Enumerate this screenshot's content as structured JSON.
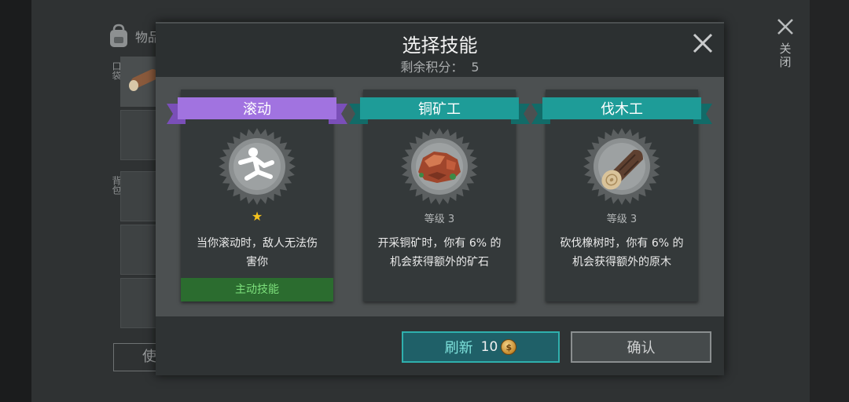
{
  "background": {
    "inventory_title": "物品",
    "pocket_label": "口袋",
    "backpack_label": "背包",
    "use_button": "使用",
    "close_label": "关闭"
  },
  "dialog": {
    "title": "选择技能",
    "points_label": "剩余积分：",
    "points_value": "5"
  },
  "cards": [
    {
      "name": "滚动",
      "ribbon_color": "#a173e0",
      "ribbon_dark": "#7a4fb8",
      "icon": "rolling-person-icon",
      "stars": "★",
      "description_lines": [
        "当你滚动时，敌人无法伤",
        "害你"
      ],
      "status": "主动技能"
    },
    {
      "name": "铜矿工",
      "ribbon_color": "#1e9c98",
      "ribbon_dark": "#126b68",
      "icon": "copper-ore-icon",
      "level": "等级 3",
      "description_lines": [
        "开采铜矿时，你有 6% 的",
        "机会获得额外的矿石"
      ]
    },
    {
      "name": "伐木工",
      "ribbon_color": "#1e9c98",
      "ribbon_dark": "#126b68",
      "icon": "wood-log-icon",
      "level": "等级 3",
      "description_lines": [
        "砍伐橡树时，你有 6% 的",
        "机会获得额外的原木"
      ]
    }
  ],
  "buttons": {
    "refresh_label": "刷新",
    "refresh_cost": "10",
    "confirm_label": "确认"
  }
}
